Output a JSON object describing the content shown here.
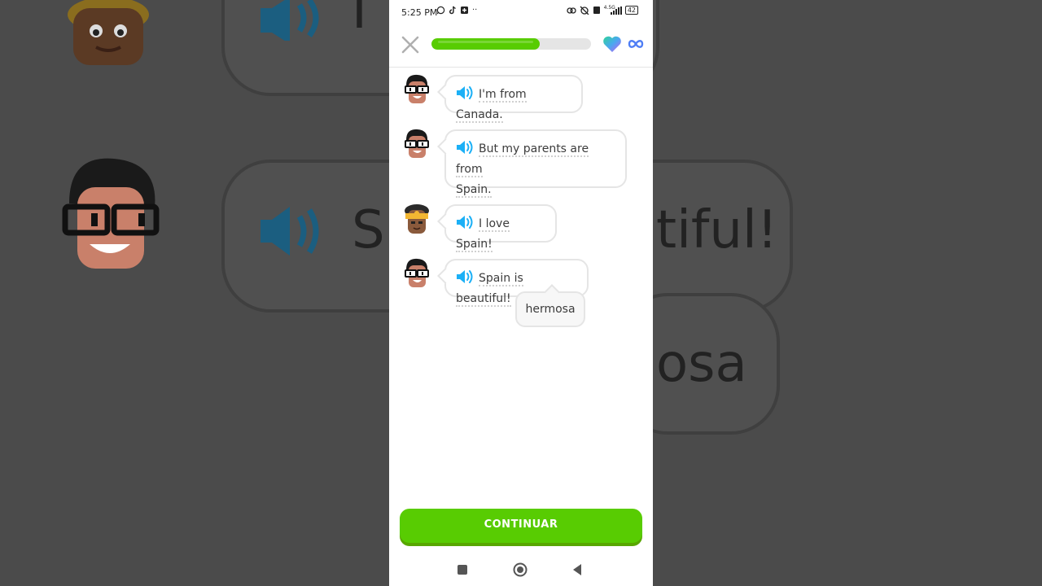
{
  "status_bar": {
    "time": "5:25 PM",
    "battery": "42",
    "network": "4.5G"
  },
  "progress": {
    "fraction": 0.68,
    "color": "#58cc02"
  },
  "messages": [
    {
      "speaker": "glasses-man",
      "text": "I'm from Canada."
    },
    {
      "speaker": "glasses-man",
      "text_line1": "But my parents are from",
      "text_line2": "Spain."
    },
    {
      "speaker": "headwrap-woman",
      "text": "I love Spain!"
    },
    {
      "speaker": "glasses-man",
      "text": "Spain is beautiful!"
    }
  ],
  "tooltip": {
    "translation": "hermosa"
  },
  "continue_button": {
    "label": "CONTINUAR"
  },
  "background": {
    "text_top": "I",
    "text_mid_left": "Sp",
    "text_mid_right": "tiful!",
    "text_bottom": "osa"
  },
  "colors": {
    "accent_green": "#58cc02",
    "speaker_blue": "#1cb0f6",
    "border": "#e5e5e5"
  }
}
